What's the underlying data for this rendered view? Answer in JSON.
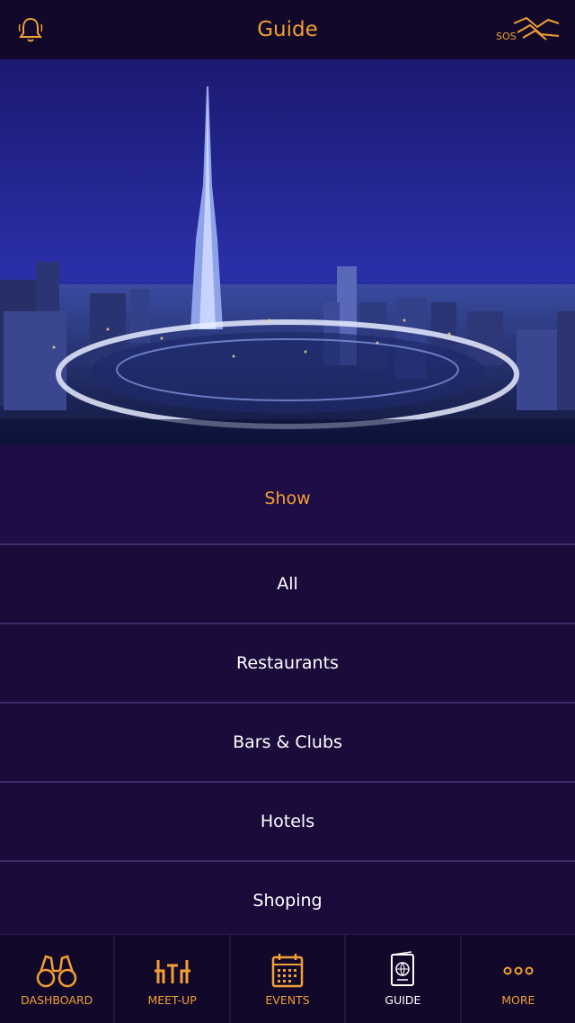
{
  "header": {
    "title": "Guide",
    "sos_label": "SOS"
  },
  "filter": {
    "heading": "Show",
    "items": [
      {
        "label": "All"
      },
      {
        "label": "Restaurants"
      },
      {
        "label": "Bars & Clubs"
      },
      {
        "label": "Hotels"
      },
      {
        "label": "Shoping"
      }
    ]
  },
  "tabs": [
    {
      "label": "DASHBOARD",
      "icon": "binoculars-icon"
    },
    {
      "label": "MEET-UP",
      "icon": "meetup-icon"
    },
    {
      "label": "EVENTS",
      "icon": "calendar-icon"
    },
    {
      "label": "GUIDE",
      "icon": "passport-icon",
      "active": true
    },
    {
      "label": "MORE",
      "icon": "more-icon"
    }
  ],
  "colors": {
    "accent": "#f0a034",
    "background": "#1a0b3b",
    "header": "#12082a",
    "divider": "#3a2d68"
  }
}
